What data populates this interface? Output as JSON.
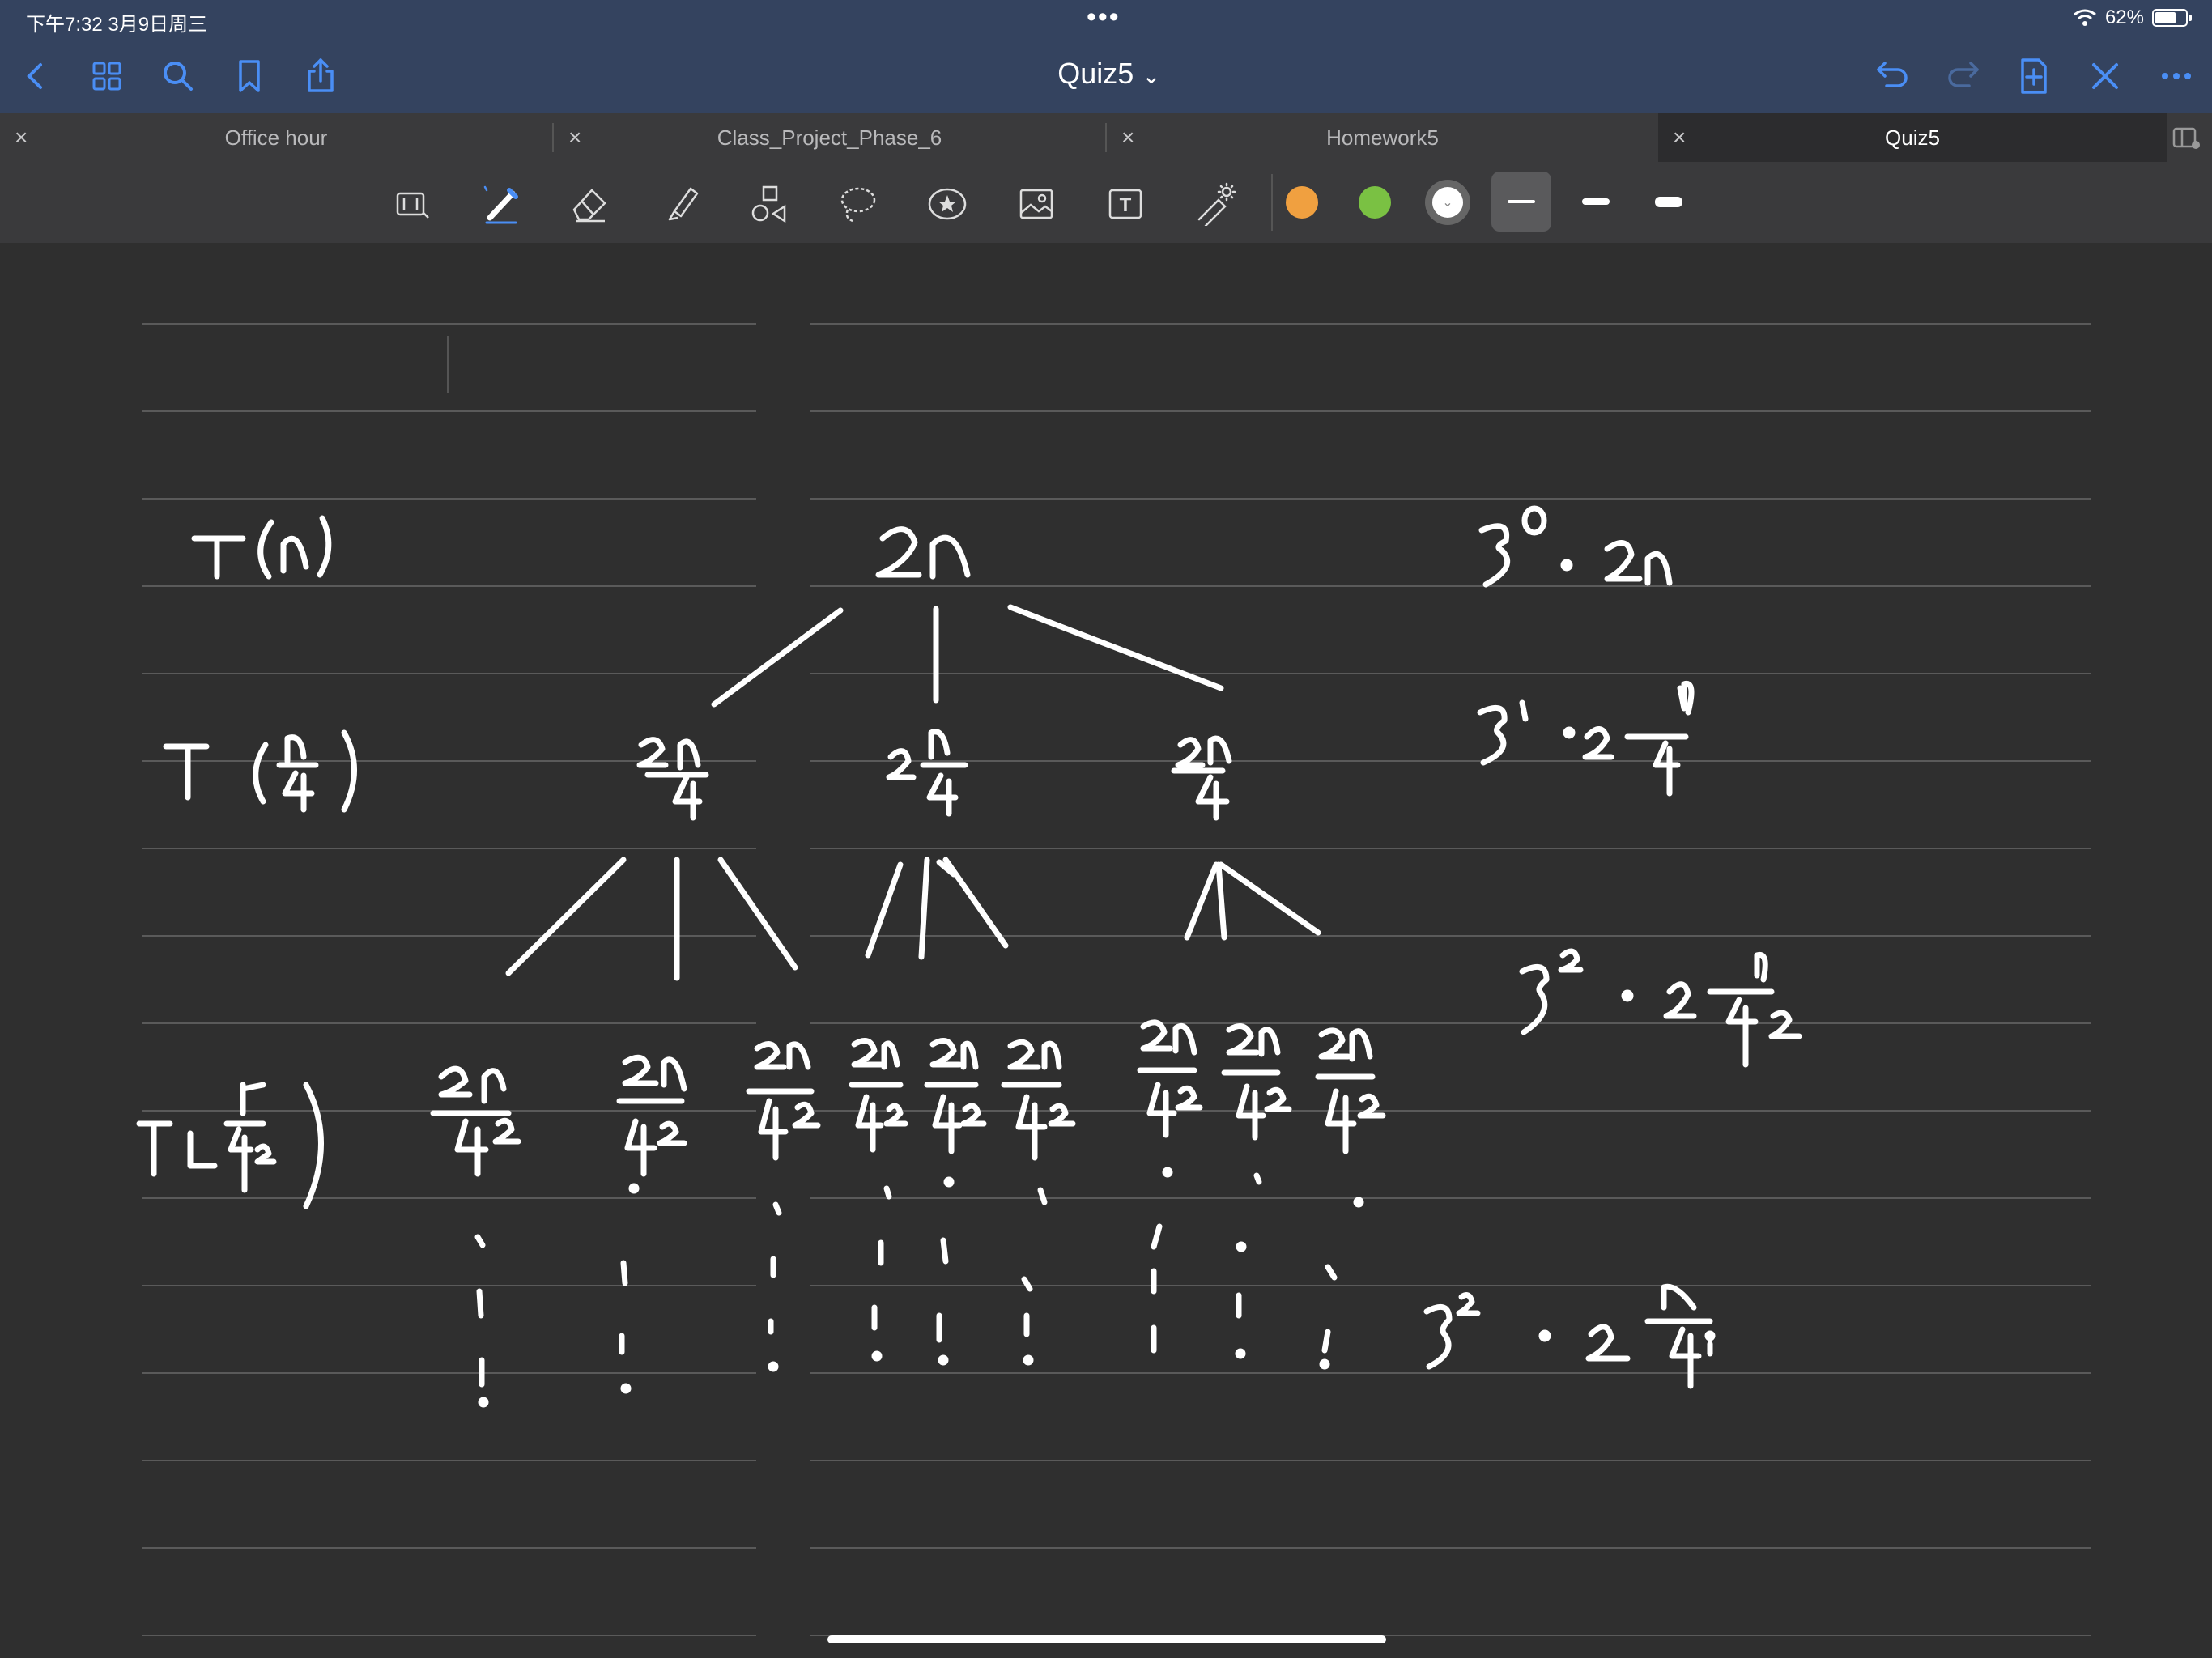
{
  "status": {
    "time": "下午7:32   3月9日周三",
    "battery_text": "62%",
    "dots": "•••"
  },
  "nav": {
    "title": "Quiz5",
    "chevron": "⌄"
  },
  "tabs": [
    {
      "label": "Office hour",
      "close": "×",
      "active": false
    },
    {
      "label": "Class_Project_Phase_6",
      "close": "×",
      "active": false
    },
    {
      "label": "Homework5",
      "close": "×",
      "active": false
    },
    {
      "label": "Quiz5",
      "close": "×",
      "active": true
    }
  ],
  "toolbar": {
    "tools": [
      "keyboard-scan-icon",
      "pen-icon",
      "eraser-icon",
      "highlighter-icon",
      "shapes-icon",
      "lasso-icon",
      "sticker-icon",
      "image-icon",
      "text-icon",
      "laser-pointer-icon"
    ],
    "colors": [
      "#f0a040",
      "#7ac143",
      "#ffffff"
    ],
    "selected_color": "#ffffff",
    "stroke_sizes": [
      "thin",
      "medium",
      "thick"
    ],
    "selected_stroke": "thin"
  }
}
